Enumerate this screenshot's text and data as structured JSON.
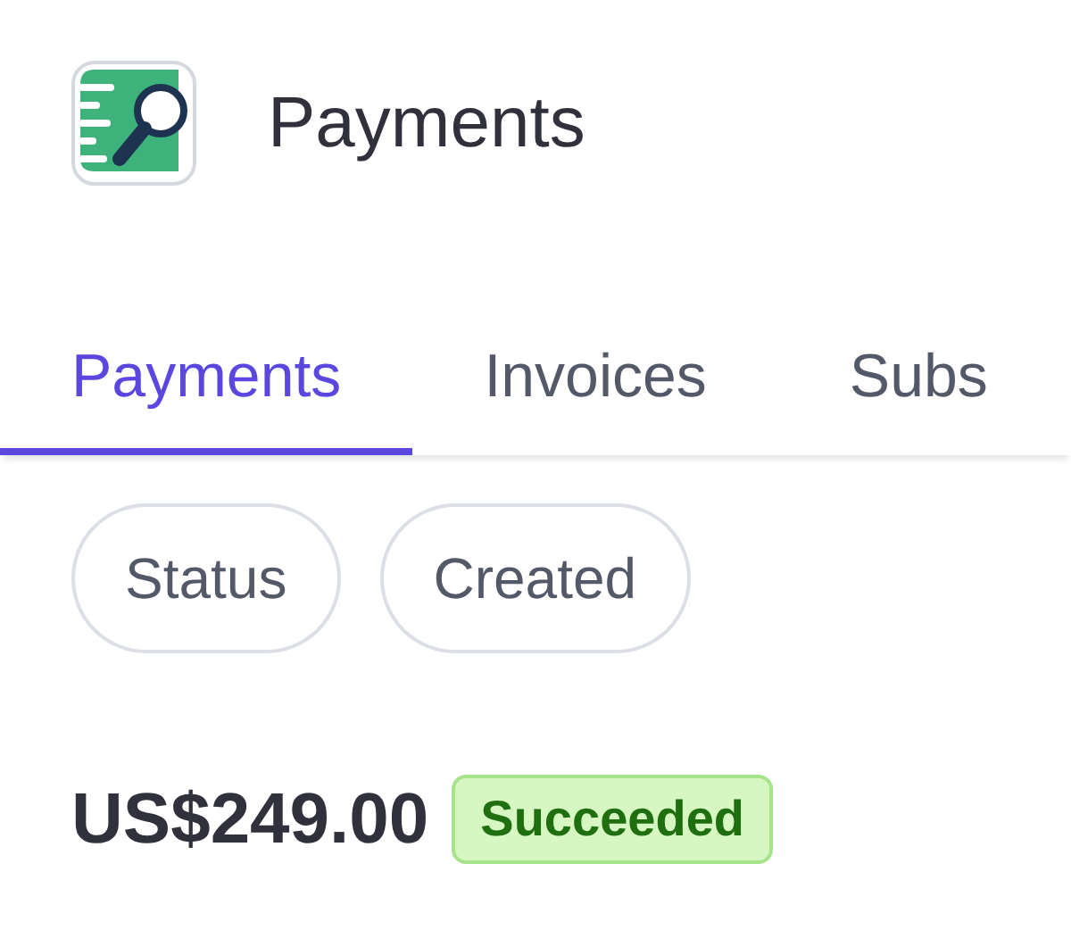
{
  "header": {
    "title": "Payments"
  },
  "tabs": [
    {
      "label": "Payments",
      "selected": true
    },
    {
      "label": "Invoices",
      "selected": false
    },
    {
      "label": "Subs",
      "selected": false
    }
  ],
  "filters": [
    {
      "label": "Status"
    },
    {
      "label": "Created"
    }
  ],
  "payment": {
    "amount": "US$249.00",
    "status": "Succeeded",
    "kind": "success"
  }
}
